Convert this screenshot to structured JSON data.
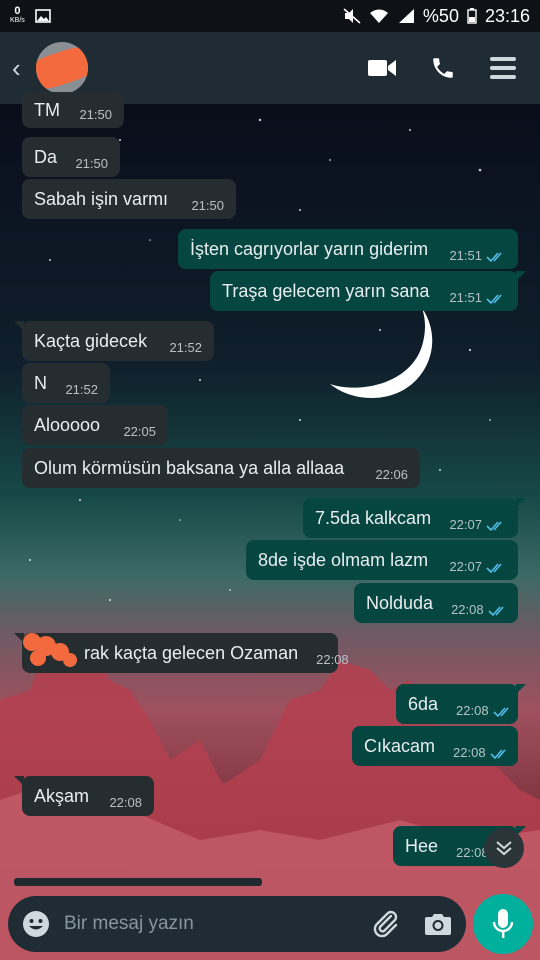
{
  "status_bar": {
    "speed_value": "0",
    "speed_unit": "KB/s",
    "battery": "%50",
    "time": "23:16"
  },
  "header": {
    "icons": [
      "video-call-icon",
      "phone-icon",
      "menu-icon"
    ]
  },
  "messages": [
    {
      "text": "TM",
      "time": "21:50",
      "dir": "in"
    },
    {
      "text": "Da",
      "time": "21:50",
      "dir": "in"
    },
    {
      "text": "Sabah işin varmı",
      "time": "21:50",
      "dir": "in"
    },
    {
      "text": "İşten cagrıyorlar yarın giderim",
      "time": "21:51",
      "dir": "out"
    },
    {
      "text": "Traşa gelecem yarın sana",
      "time": "21:51",
      "dir": "out"
    },
    {
      "text": "Kaçta gidecek",
      "time": "21:52",
      "dir": "in"
    },
    {
      "text": "N",
      "time": "21:52",
      "dir": "in"
    },
    {
      "text": "Alooooo",
      "time": "22:05",
      "dir": "in"
    },
    {
      "text": "Olum körmüsün baksana ya alla allaaa",
      "time": "22:06",
      "dir": "in"
    },
    {
      "text": "7.5da kalkcam",
      "time": "22:07",
      "dir": "out"
    },
    {
      "text": "8de işde olmam lazm",
      "time": "22:07",
      "dir": "out"
    },
    {
      "text": "Nolduda",
      "time": "22:08",
      "dir": "out"
    },
    {
      "text": "rak kaçta gelecen Ozaman",
      "time": "22:08",
      "dir": "in"
    },
    {
      "text": "6da",
      "time": "22:08",
      "dir": "out"
    },
    {
      "text": "Cıkacam",
      "time": "22:08",
      "dir": "out"
    },
    {
      "text": "Akşam",
      "time": "22:08",
      "dir": "in"
    },
    {
      "text": "Hee",
      "time": "22:08",
      "dir": "out"
    }
  ],
  "input": {
    "placeholder": "Bir mesaj yazın"
  },
  "colors": {
    "incoming_bubble": "#262d31",
    "outgoing_bubble": "#054740",
    "read_ticks": "#53bdeb",
    "mic_button": "#00af9c",
    "header": "#1f2c34"
  }
}
